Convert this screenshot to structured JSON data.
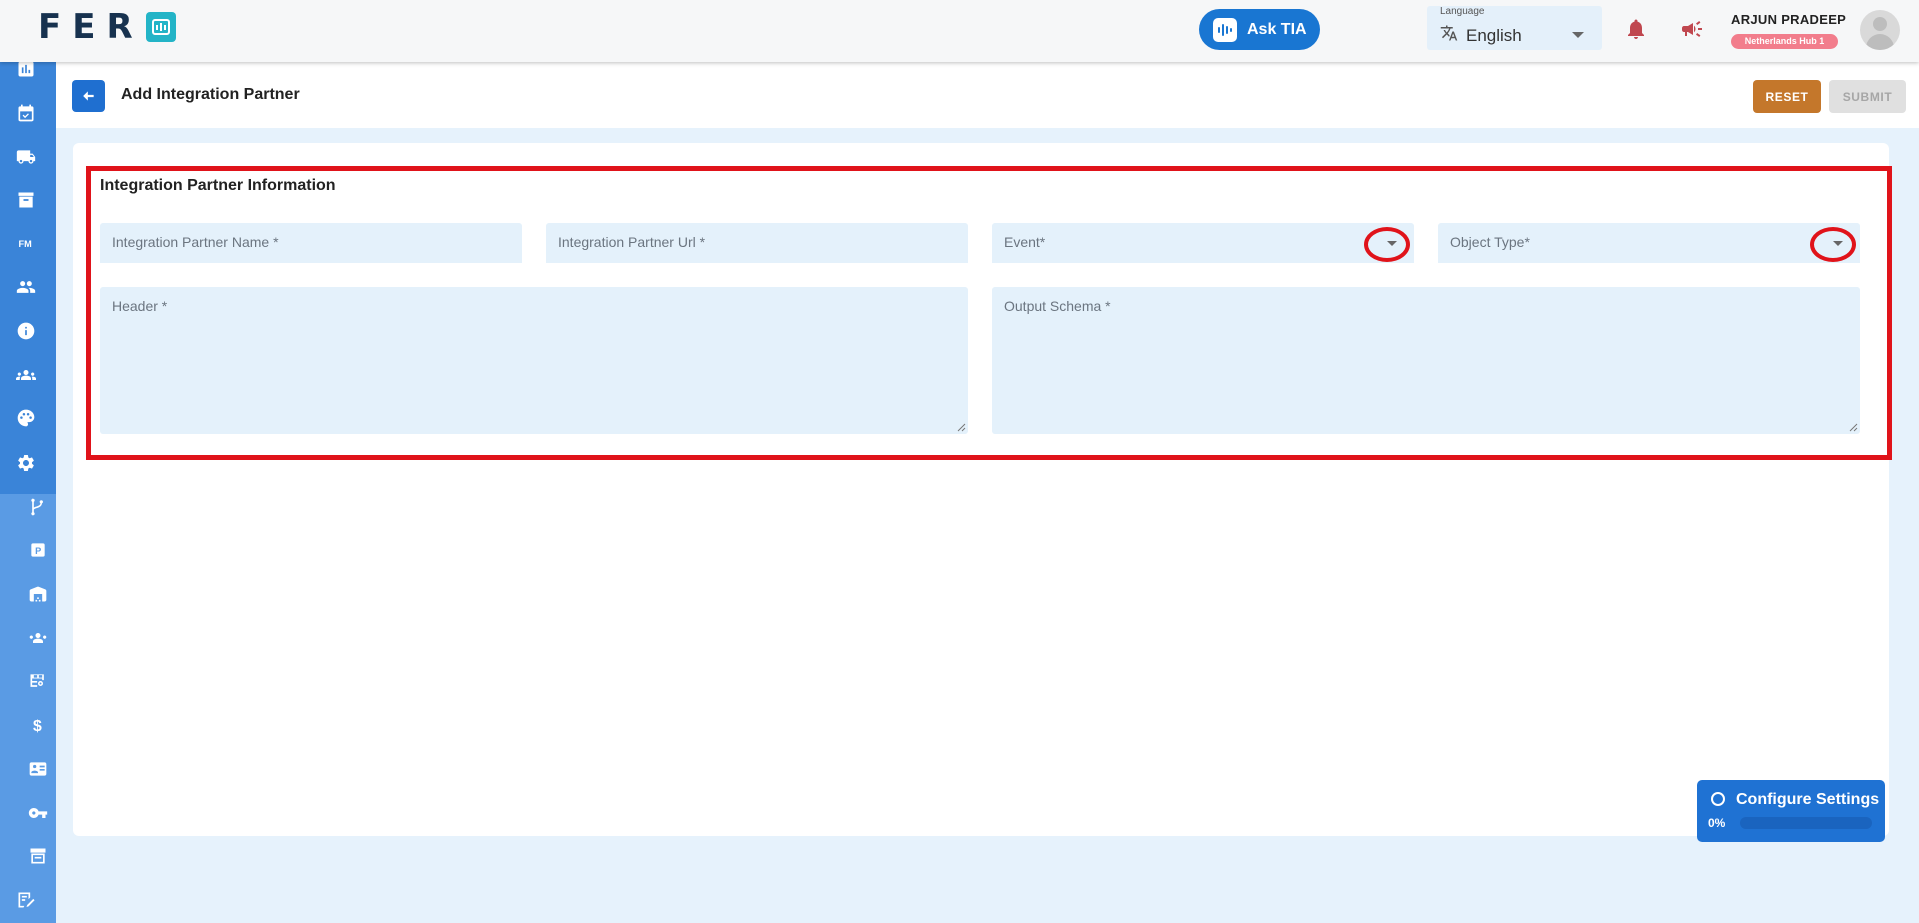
{
  "app": {
    "logo_text": "FER"
  },
  "topbar": {
    "ask_tia_label": "Ask TIA",
    "language": {
      "label": "Language",
      "value": "English"
    },
    "user": {
      "name": "ARJUN PRADEEP",
      "hub": "Netherlands Hub 1"
    }
  },
  "sidebar": {
    "items": [
      {
        "icon": "analytics-icon"
      },
      {
        "icon": "calendar-icon"
      },
      {
        "icon": "delivery-truck-icon"
      },
      {
        "icon": "archive-box-icon"
      },
      {
        "icon": "fm-icon",
        "text": "FM"
      },
      {
        "icon": "users-icon"
      },
      {
        "icon": "info-icon"
      },
      {
        "icon": "group-icon"
      },
      {
        "icon": "palette-icon"
      },
      {
        "icon": "settings-gear-icon"
      }
    ],
    "sub_items": [
      {
        "icon": "branch-icon"
      },
      {
        "icon": "parking-icon",
        "text": "P"
      },
      {
        "icon": "warehouse-icon"
      },
      {
        "icon": "team-icon"
      },
      {
        "icon": "table-settings-icon"
      },
      {
        "icon": "dollar-icon",
        "text": "$"
      },
      {
        "icon": "id-card-icon"
      },
      {
        "icon": "key-icon"
      },
      {
        "icon": "inventory-icon"
      },
      {
        "icon": "edit-note-icon"
      }
    ]
  },
  "page": {
    "title": "Add Integration Partner",
    "reset_label": "RESET",
    "submit_label": "SUBMIT"
  },
  "form": {
    "section_title": "Integration Partner Information",
    "fields": {
      "partner_name": "Integration Partner Name *",
      "partner_url": "Integration Partner Url *",
      "event": "Event*",
      "object_type": "Object Type*",
      "header": "Header *",
      "output_schema": "Output Schema *"
    }
  },
  "configure": {
    "title": "Configure Settings",
    "progress_label": "0%",
    "progress": 0
  },
  "colors": {
    "primary": "#1976d2",
    "sidebar": "#3a84d8",
    "reset": "#c4772b",
    "highlight": "#e0131a",
    "field_bg": "#e4f1fb"
  }
}
